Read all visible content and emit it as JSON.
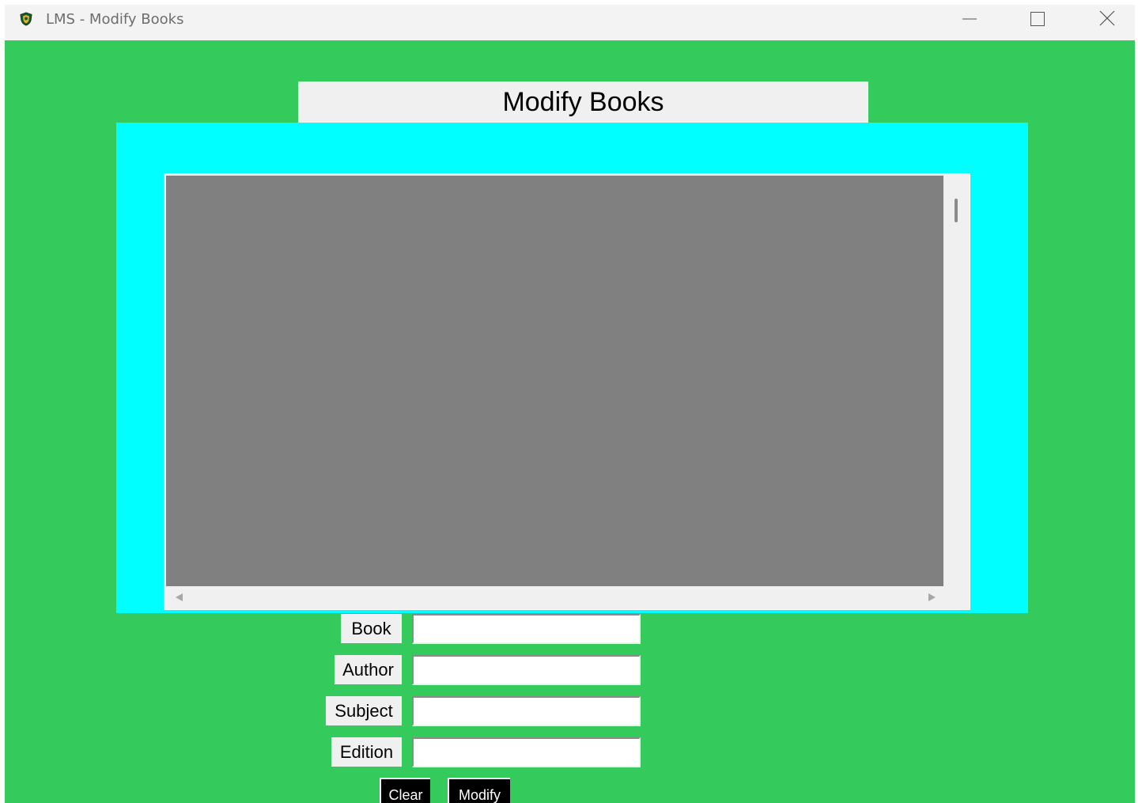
{
  "window": {
    "title": "LMS - Modify Books",
    "icon": "shield-icon",
    "controls": [
      "minimize-icon",
      "maximize-icon",
      "close-icon"
    ]
  },
  "heading": "Modify Books",
  "colors": {
    "background": "#35ca5c",
    "frame": "#00ffff",
    "listbox": "#808080",
    "button": "#000000"
  },
  "form": {
    "fields": [
      {
        "label": "Book",
        "value": ""
      },
      {
        "label": "Author",
        "value": ""
      },
      {
        "label": "Subject",
        "value": ""
      },
      {
        "label": "Edition",
        "value": ""
      }
    ]
  },
  "buttons": {
    "clear": "Clear",
    "modify": "Modify"
  }
}
